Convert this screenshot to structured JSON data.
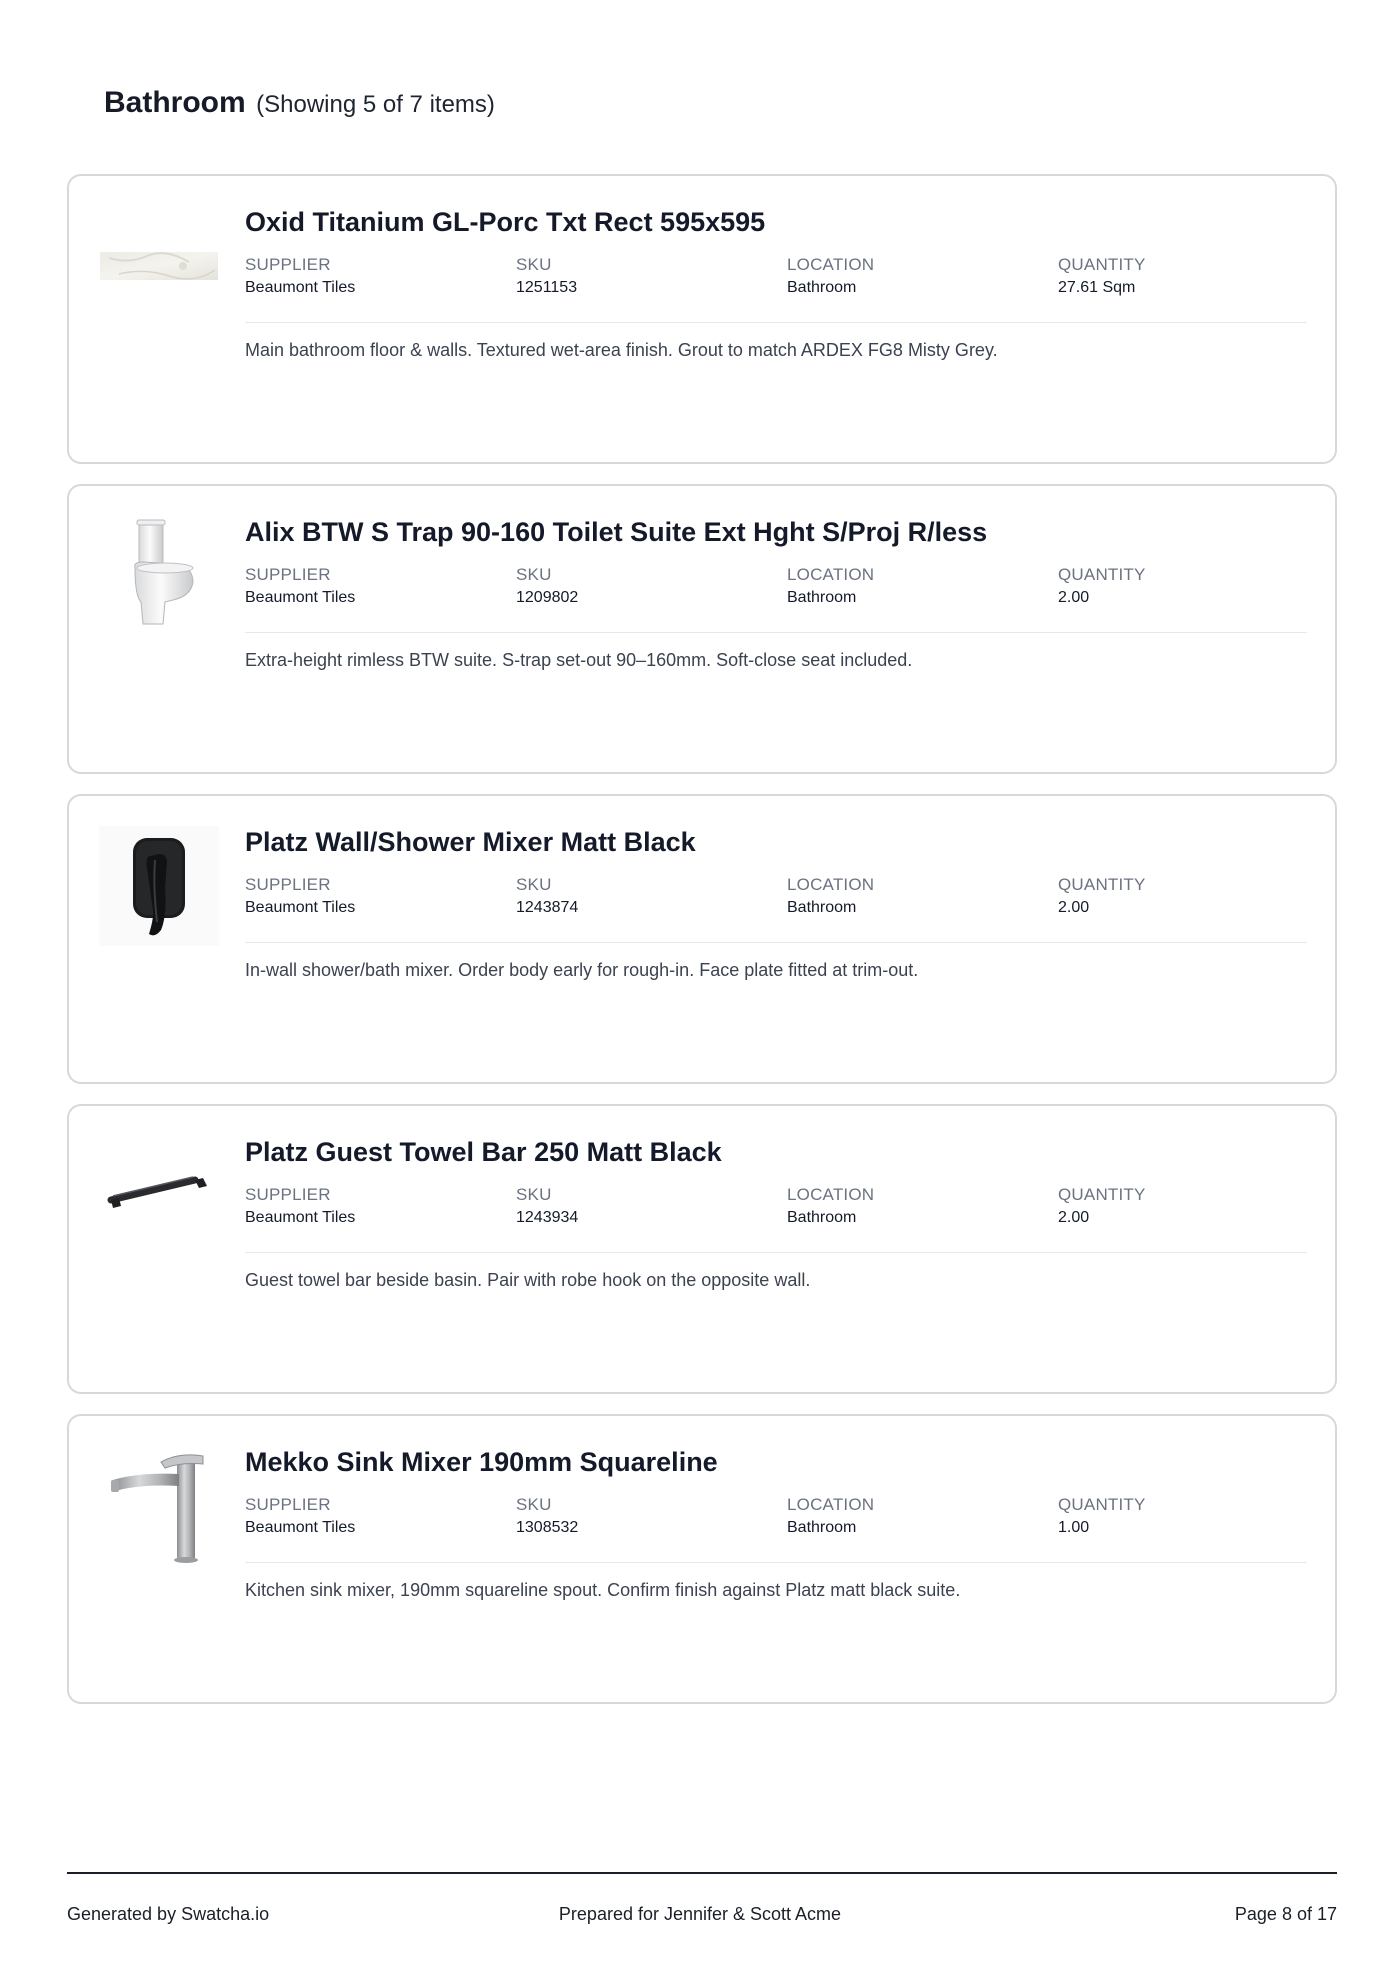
{
  "section": {
    "title": "Bathroom",
    "count_text": "(Showing 5 of 7 items)"
  },
  "labels": {
    "supplier": "SUPPLIER",
    "sku": "SKU",
    "location": "LOCATION",
    "quantity": "QUANTITY"
  },
  "items": [
    {
      "title": "Oxid Titanium GL-Porc Txt Rect 595x595",
      "supplier": "Beaumont Tiles",
      "sku": "1251153",
      "location": "Bathroom",
      "quantity": "27.61 Sqm",
      "note": "Main bathroom floor & walls. Textured wet-area finish. Grout to match ARDEX FG8 Misty Grey.",
      "image_icon": "tile-swatch-icon"
    },
    {
      "title": "Alix BTW S Trap 90-160 Toilet Suite Ext Hght S/Proj R/less",
      "supplier": "Beaumont Tiles",
      "sku": "1209802",
      "location": "Bathroom",
      "quantity": "2.00",
      "note": "Extra-height rimless BTW suite. S-trap set-out 90–160mm. Soft-close seat included.",
      "image_icon": "toilet-suite-icon"
    },
    {
      "title": "Platz Wall/Shower Mixer Matt Black",
      "supplier": "Beaumont Tiles",
      "sku": "1243874",
      "location": "Bathroom",
      "quantity": "2.00",
      "note": "In-wall shower/bath mixer. Order body early for rough-in. Face plate fitted at trim-out.",
      "image_icon": "shower-mixer-icon"
    },
    {
      "title": "Platz Guest Towel Bar 250 Matt Black",
      "supplier": "Beaumont Tiles",
      "sku": "1243934",
      "location": "Bathroom",
      "quantity": "2.00",
      "note": "Guest towel bar beside basin. Pair with robe hook on the opposite wall.",
      "image_icon": "towel-bar-icon"
    },
    {
      "title": "Mekko Sink Mixer 190mm Squareline",
      "supplier": "Beaumont Tiles",
      "sku": "1308532",
      "location": "Bathroom",
      "quantity": "1.00",
      "note": "Kitchen sink mixer, 190mm squareline spout. Confirm finish against Platz matt black suite.",
      "image_icon": "sink-mixer-icon"
    }
  ],
  "footer": {
    "generated": "Generated by Swatcha.io",
    "prepared": "Prepared for Jennifer & Scott Acme",
    "page": "Page 8 of 17"
  }
}
